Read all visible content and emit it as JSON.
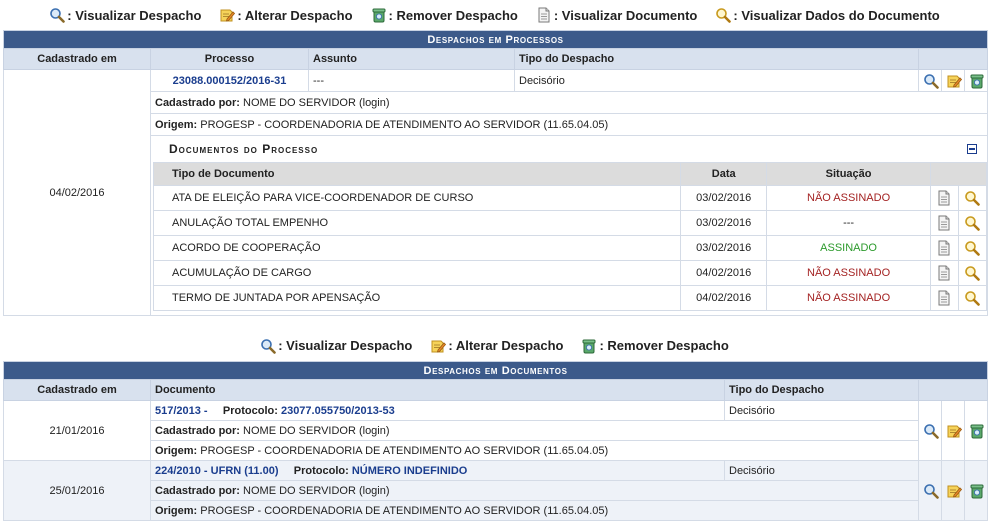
{
  "legend_top": [
    {
      "icon": "magnifier-icon",
      "label": ": Visualizar Despacho"
    },
    {
      "icon": "edit-note-icon",
      "label": ": Alterar Despacho"
    },
    {
      "icon": "trash-icon",
      "label": ": Remover Despacho"
    },
    {
      "icon": "document-icon",
      "label": ": Visualizar Documento"
    },
    {
      "icon": "magnifier-yellow-icon",
      "label": ": Visualizar Dados do Documento"
    }
  ],
  "processos": {
    "caption": "Despachos em Processos",
    "headers": {
      "cadastrado": "Cadastrado em",
      "processo": "Processo",
      "assunto": "Assunto",
      "tipo": "Tipo do Despacho"
    },
    "row": {
      "cadastrado": "04/02/2016",
      "processo": "23088.000152/2016-31",
      "assunto": "---",
      "tipo": "Decisório",
      "cadastrado_por_label": "Cadastrado por:",
      "cadastrado_por": "NOME DO SERVIDOR (login)",
      "origem_label": "Origem:",
      "origem": "PROGESP - COORDENADORIA DE ATENDIMENTO AO SERVIDOR (11.65.04.05)"
    },
    "documentos": {
      "title": "Documentos do Processo",
      "headers": {
        "tipo": "Tipo de Documento",
        "data": "Data",
        "situacao": "Situação"
      },
      "items": [
        {
          "tipo": "ATA DE ELEIÇÃO PARA VICE-COORDENADOR DE CURSO",
          "data": "03/02/2016",
          "situacao": "NÃO ASSINADO"
        },
        {
          "tipo": "ANULAÇÃO TOTAL EMPENHO",
          "data": "03/02/2016",
          "situacao": "---"
        },
        {
          "tipo": "ACORDO DE COOPERAÇÃO",
          "data": "03/02/2016",
          "situacao": "ASSINADO"
        },
        {
          "tipo": "ACUMULAÇÃO DE CARGO",
          "data": "04/02/2016",
          "situacao": "NÃO ASSINADO"
        },
        {
          "tipo": "TERMO DE JUNTADA POR APENSAÇÃO",
          "data": "04/02/2016",
          "situacao": "NÃO ASSINADO"
        }
      ]
    }
  },
  "legend_bottom": [
    {
      "icon": "magnifier-icon",
      "label": ": Visualizar Despacho"
    },
    {
      "icon": "edit-note-icon",
      "label": ": Alterar Despacho"
    },
    {
      "icon": "trash-icon",
      "label": ": Remover Despacho"
    }
  ],
  "documentos_desp": {
    "caption": "Despachos em Documentos",
    "headers": {
      "cadastrado": "Cadastrado em",
      "documento": "Documento",
      "tipo": "Tipo do Despacho"
    },
    "rows": [
      {
        "cadastrado": "21/01/2016",
        "documento": "517/2013 -",
        "protocolo_label": "Protocolo:",
        "protocolo": "23077.055750/2013-53",
        "tipo": "Decisório",
        "cadastrado_por_label": "Cadastrado por:",
        "cadastrado_por": "NOME DO SERVIDOR (login)",
        "origem_label": "Origem:",
        "origem": "PROGESP - COORDENADORIA DE ATENDIMENTO AO SERVIDOR (11.65.04.05)"
      },
      {
        "cadastrado": "25/01/2016",
        "documento": "224/2010 - UFRN (11.00)",
        "protocolo_label": "Protocolo:",
        "protocolo": "NÚMERO INDEFINIDO",
        "tipo": "Decisório",
        "cadastrado_por_label": "Cadastrado por:",
        "cadastrado_por": "NOME DO SERVIDOR (login)",
        "origem_label": "Origem:",
        "origem": "PROGESP - COORDENADORIA DE ATENDIMENTO AO SERVIDOR (11.65.04.05)"
      }
    ]
  },
  "colors": {
    "header": "#3c5a8a",
    "subheader": "#d8e1ee",
    "link": "#1a3d8e",
    "nao_assinado": "#a42323",
    "assinado": "#2c9a2c"
  }
}
